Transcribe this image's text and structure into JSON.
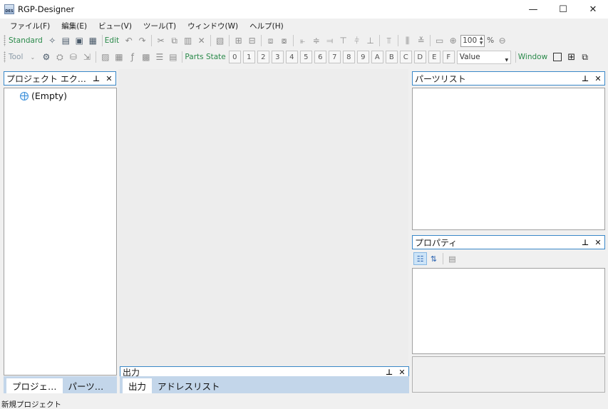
{
  "window": {
    "title": "RGP-Designer",
    "icon_text": "DES",
    "minimize": "—",
    "maximize": "☐",
    "close": "✕"
  },
  "menu": [
    "ファイル(F)",
    "編集(E)",
    "ビュー(V)",
    "ツール(T)",
    "ウィンドウ(W)",
    "ヘルプ(H)"
  ],
  "toolbar_standard": {
    "label": "Standard",
    "edit_label": "Edit",
    "zoom_value": "100",
    "zoom_unit": "%"
  },
  "toolbar_tool": {
    "label": "Tool",
    "parts_state_label": "Parts State",
    "states": [
      "0",
      "1",
      "2",
      "3",
      "4",
      "5",
      "6",
      "7",
      "8",
      "9",
      "A",
      "B",
      "C",
      "D",
      "E",
      "F"
    ],
    "value_label": "Value",
    "window_label": "Window"
  },
  "project_explorer": {
    "title": "プロジェクト エク…",
    "items": [
      "(Empty)"
    ],
    "tabs": [
      "プロジェ…",
      "パーツ…"
    ]
  },
  "parts_list": {
    "title": "パーツリスト"
  },
  "properties": {
    "title": "プロパティ"
  },
  "output": {
    "title": "出力",
    "tabs": [
      "出力",
      "アドレスリスト"
    ]
  },
  "panel_buttons": {
    "pin": "⊥",
    "close": "✕"
  },
  "status": {
    "text": "新規プロジェクト"
  },
  "colors": {
    "accent_border": "#3a88c8",
    "toolbar_label": "#2a8a4a",
    "tab_strip": "#c3d6ea"
  }
}
